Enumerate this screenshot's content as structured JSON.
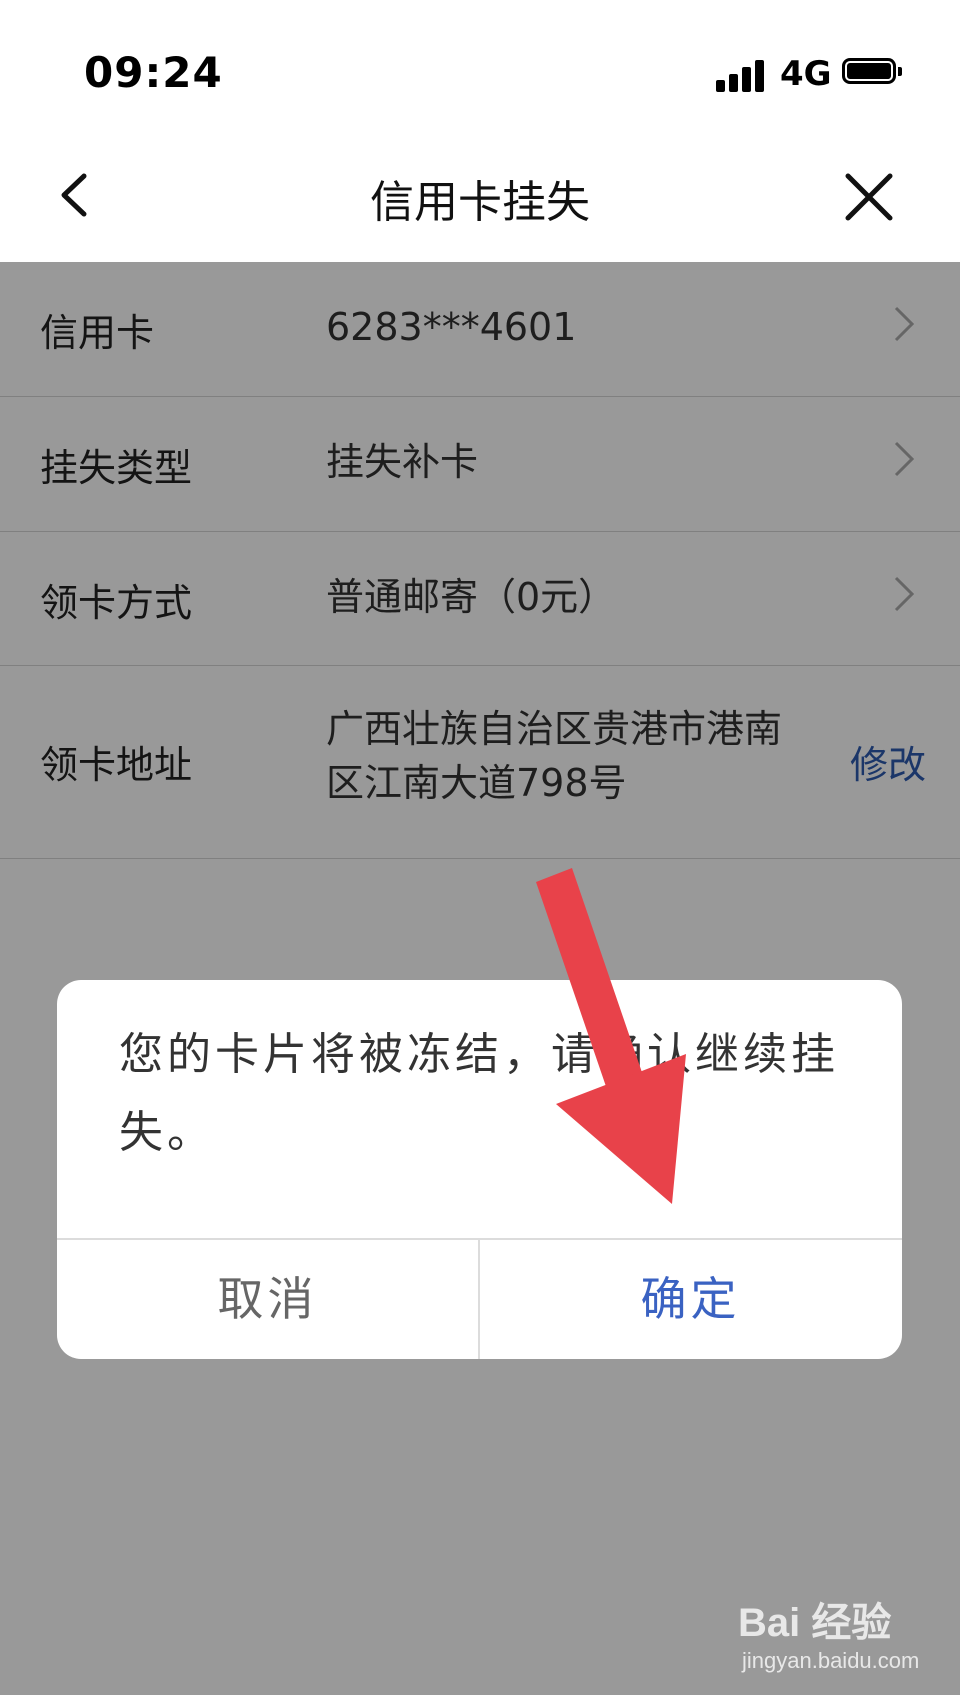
{
  "status_bar": {
    "time": "09:24",
    "network": "4G"
  },
  "nav": {
    "title": "信用卡挂失",
    "back_icon": "chevron-left-icon",
    "close_icon": "close-icon"
  },
  "form": {
    "rows": [
      {
        "label": "信用卡",
        "value": "6283***4601",
        "has_chevron": true
      },
      {
        "label": "挂失类型",
        "value": "挂失补卡",
        "has_chevron": true
      },
      {
        "label": "领卡方式",
        "value": "普通邮寄（0元）",
        "has_chevron": true
      },
      {
        "label": "领卡地址",
        "value_line1": "广西壮族自治区贵港市港南",
        "value_line2": "区江南大道798号",
        "action": "修改"
      }
    ]
  },
  "dialog": {
    "message": "您的卡片将被冻结，请确认继续挂失。",
    "cancel_label": "取消",
    "confirm_label": "确定"
  },
  "watermark": {
    "logo": "Bai 经验",
    "url": "jingyan.baidu.com"
  },
  "colors": {
    "accent": "#3a62c2",
    "arrow": "#e8424a",
    "overlay": "rgba(0,0,0,0.40)"
  }
}
